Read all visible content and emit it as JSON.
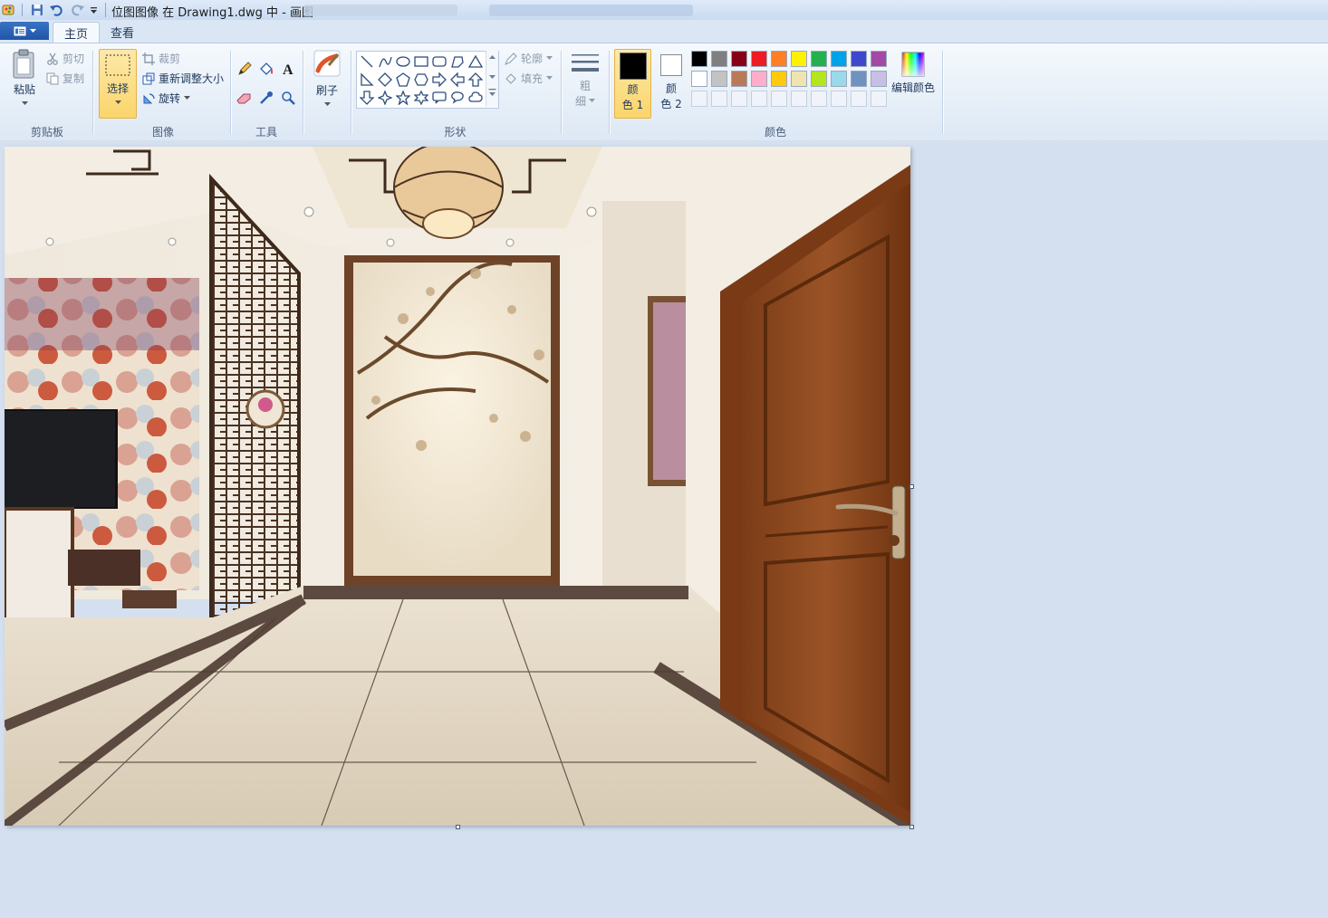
{
  "window": {
    "title": "位图图像 在 Drawing1.dwg 中 - 画图"
  },
  "quick_access": {
    "icons": [
      "app-icon",
      "save-icon",
      "undo-icon",
      "redo-icon",
      "customize-icon"
    ]
  },
  "tabs": [
    {
      "label": "主页",
      "active": true
    },
    {
      "label": "查看",
      "active": false
    }
  ],
  "ribbon": {
    "clipboard": {
      "group_label": "剪贴板",
      "paste": "粘贴",
      "cut": "剪切",
      "copy": "复制"
    },
    "image": {
      "group_label": "图像",
      "select": "选择",
      "crop": "裁剪",
      "resize": "重新调整大小",
      "rotate": "旋转"
    },
    "tools": {
      "group_label": "工具",
      "items": [
        "pencil-icon",
        "fill-bucket-icon",
        "text-icon",
        "eraser-icon",
        "color-picker-icon",
        "magnifier-icon"
      ]
    },
    "brushes": {
      "label": "刷子"
    },
    "shapes": {
      "group_label": "形状",
      "outline": "轮廓",
      "fill": "填充"
    },
    "size": {
      "label_line1": "粗",
      "label_line2": "细"
    },
    "colors": {
      "group_label": "颜色",
      "color1_line1": "颜",
      "color1_line2": "色 1",
      "color2_line1": "颜",
      "color2_line2": "色 2",
      "color1": "#000000",
      "color2": "#ffffff",
      "edit_colors": "编辑颜色",
      "palette_row1": [
        "#000000",
        "#7f7f7f",
        "#880015",
        "#ed1c24",
        "#ff7f27",
        "#fff200",
        "#22b14c",
        "#00a2e8",
        "#3f48cc",
        "#a349a4"
      ],
      "palette_row2": [
        "#ffffff",
        "#c3c3c3",
        "#b97a57",
        "#ffaec9",
        "#ffc90e",
        "#efe4b0",
        "#b5e61d",
        "#99d9ea",
        "#7092be",
        "#c8bfe7"
      ]
    }
  },
  "colors": {
    "ribbon_bg": "#f5f9fd",
    "workspace_bg": "#d4e0ef",
    "selection_orange": "#fbd56c"
  }
}
